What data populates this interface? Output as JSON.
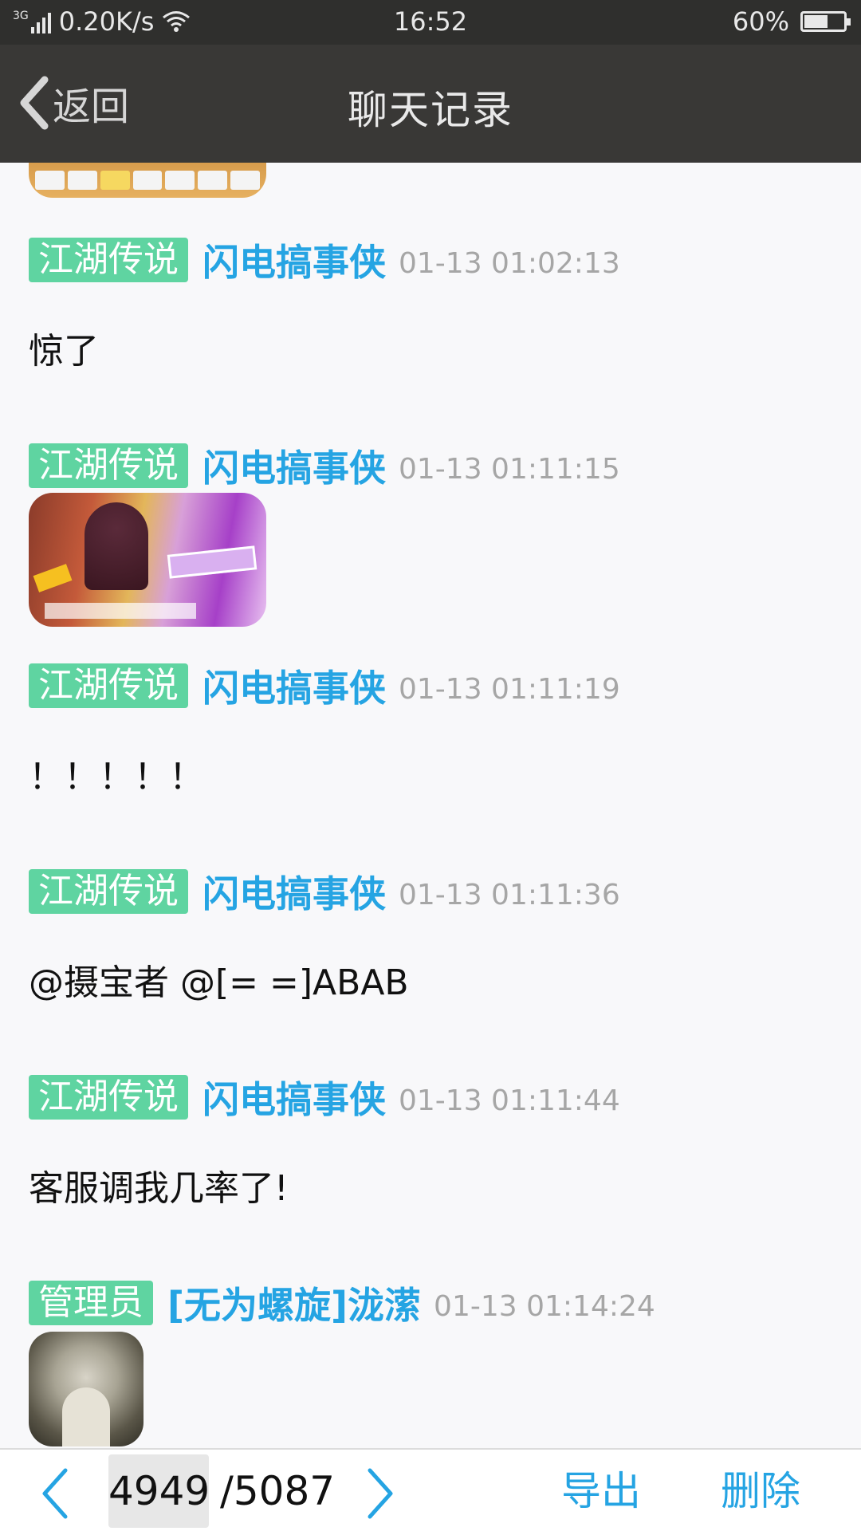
{
  "status_bar": {
    "network": "3G",
    "speed": "0.20K/s",
    "time": "16:52",
    "battery": "60%",
    "battery_level": 0.6
  },
  "nav": {
    "back_label": "返回",
    "title": "聊天记录"
  },
  "messages": [
    {
      "tag": "江湖传说",
      "nick": "闪电搞事侠",
      "time": "01-13 01:02:13",
      "text": "惊了"
    },
    {
      "tag": "江湖传说",
      "nick": "闪电搞事侠",
      "time": "01-13 01:11:15",
      "image": "game-card-image"
    },
    {
      "tag": "江湖传说",
      "nick": "闪电搞事侠",
      "time": "01-13 01:11:19",
      "text": "！！！！！"
    },
    {
      "tag": "江湖传说",
      "nick": "闪电搞事侠",
      "time": "01-13 01:11:36",
      "text": "@摄宝者 @[= =]ABAB"
    },
    {
      "tag": "江湖传说",
      "nick": "闪电搞事侠",
      "time": "01-13 01:11:44",
      "text": "客服调我几率了!"
    },
    {
      "tag": "管理员",
      "nick": "[无为螺旋]泷潆",
      "time": "01-13 01:14:24",
      "image": "old-man-portrait"
    }
  ],
  "bottom": {
    "current_page": "4949",
    "total_pages": "/5087",
    "export_label": "导出",
    "delete_label": "删除"
  },
  "colors": {
    "tag_bg": "#5fd4a1",
    "nick": "#25a4e3",
    "accent": "#25a4e3",
    "header_bg": "#393836"
  }
}
